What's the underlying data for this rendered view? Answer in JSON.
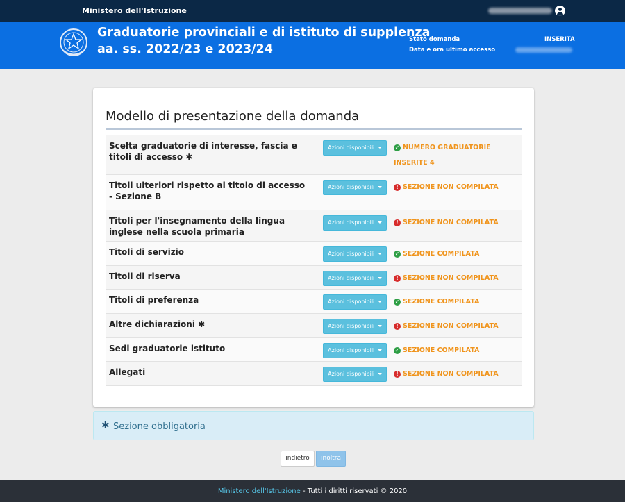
{
  "topbar": {
    "ministry": "Ministero dell'Istruzione",
    "user_icon": "user-circle-icon"
  },
  "header": {
    "title_line1": "Graduatorie provinciali e di istituto di supplenza",
    "title_line2": "aa. ss. 2022/23 e 2023/24",
    "status_label": "Stato domanda",
    "status_value": "INSERITA",
    "last_access_label": "Data e ora ultimo accesso"
  },
  "main": {
    "title": "Modello di presentazione della domanda",
    "action_label": "Azioni disponibili",
    "rows": [
      {
        "label": "Scelta graduatorie di interesse, fascia e titoli di accesso",
        "mandatory": true,
        "status": "NUMERO GRADUATORIE INSERITE 4",
        "state": "ok"
      },
      {
        "label": "Titoli ulteriori rispetto al titolo di accesso - Sezione B",
        "mandatory": false,
        "status": "SEZIONE NON COMPILATA",
        "state": "ko"
      },
      {
        "label": "Titoli per l'insegnamento della lingua inglese nella scuola primaria",
        "mandatory": false,
        "status": "SEZIONE NON COMPILATA",
        "state": "ko"
      },
      {
        "label": "Titoli di servizio",
        "mandatory": false,
        "status": "SEZIONE COMPILATA",
        "state": "ok"
      },
      {
        "label": "Titoli di riserva",
        "mandatory": false,
        "status": "SEZIONE NON COMPILATA",
        "state": "ko"
      },
      {
        "label": "Titoli di preferenza",
        "mandatory": false,
        "status": "SEZIONE COMPILATA",
        "state": "ok"
      },
      {
        "label": "Altre dichiarazioni",
        "mandatory": true,
        "status": "SEZIONE NON COMPILATA",
        "state": "ko"
      },
      {
        "label": "Sedi graduatorie istituto",
        "mandatory": false,
        "status": "SEZIONE COMPILATA",
        "state": "ok"
      },
      {
        "label": "Allegati",
        "mandatory": false,
        "status": "SEZIONE NON COMPILATA",
        "state": "ko"
      }
    ]
  },
  "notice": {
    "text": "Sezione obbligatoria"
  },
  "buttons": {
    "back": "indietro",
    "send": "inoltra"
  },
  "footer": {
    "link": "Ministero dell'Istruzione",
    "rights": " - Tutti i diritti riservati © 2020"
  },
  "colors": {
    "topbar": "#0b2846",
    "header": "#0b6fe2",
    "action_button": "#5bc0de",
    "status_text": "#f0941c",
    "status_ok": "#2e9e45",
    "status_ko": "#d72c2c"
  }
}
